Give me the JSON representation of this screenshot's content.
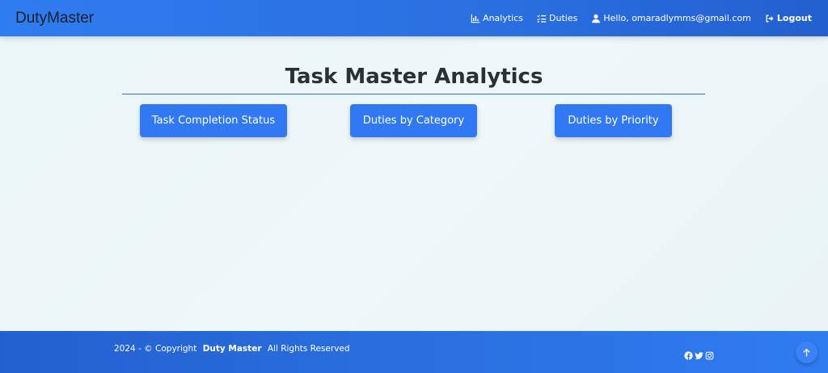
{
  "navbar": {
    "brand": "DutyMaster",
    "links": [
      {
        "label": "Analytics",
        "icon": "chart-bar-icon"
      },
      {
        "label": "Duties",
        "icon": "list-check-icon"
      },
      {
        "label": "Hello, omaradlymms@gmail.com",
        "icon": "user-icon"
      },
      {
        "label": "Logout",
        "icon": "logout-icon"
      }
    ]
  },
  "main": {
    "title": "Task Master Analytics",
    "buttons": [
      {
        "label": "Task Completion Status"
      },
      {
        "label": "Duties by Category"
      },
      {
        "label": "Duties by Priority"
      }
    ]
  },
  "footer": {
    "prefix": "2024 - © Copyright",
    "brand": "Duty Master",
    "suffix": "All Rights Reserved",
    "socials": [
      "facebook-icon",
      "twitter-icon",
      "instagram-icon"
    ],
    "back_to_top_icon": "arrow-up-icon"
  },
  "colors": {
    "primary": "#3179f2",
    "navbar": "#2a6fe0",
    "background": "#eaf6f8",
    "title": "#2b2f36"
  }
}
